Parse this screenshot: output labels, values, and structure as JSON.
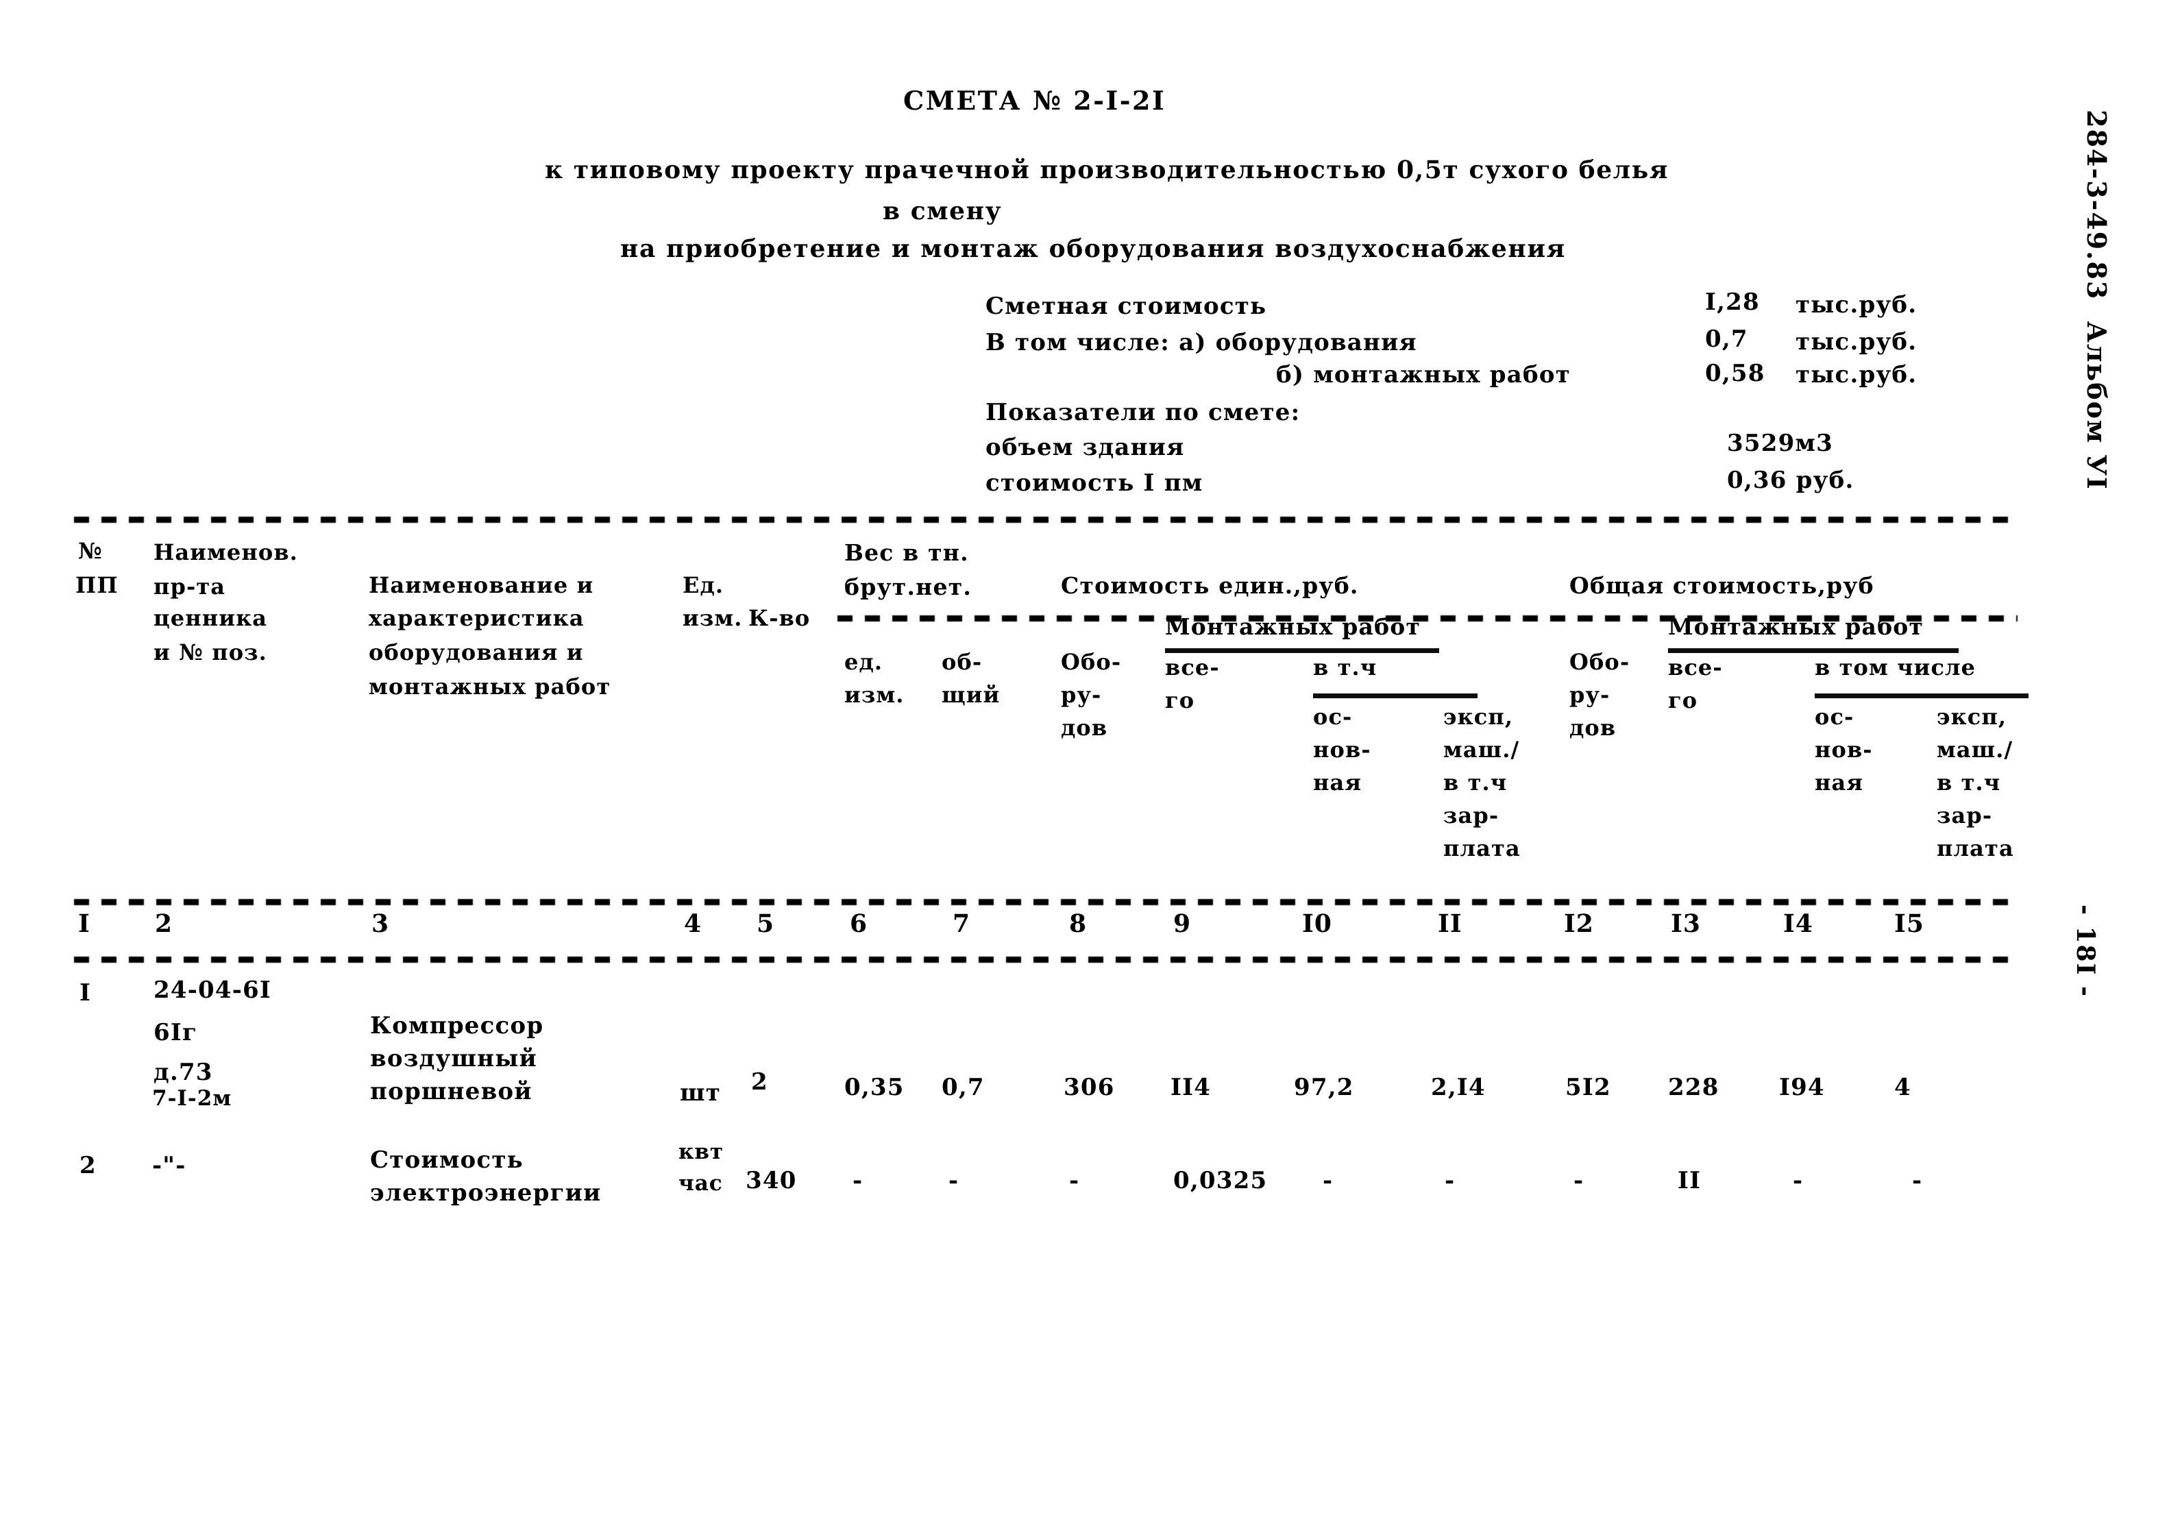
{
  "document": {
    "title": "СМЕТА № 2-I-2I",
    "subtitle_line1": "к типовому проекту прачечной производительностью 0,5т сухого белья",
    "subtitle_line2": "в смену",
    "subtitle_line3": "на приобретение и монтаж оборудования воздухоснабжения",
    "margin_code": "284-3-49.83  Альбом УI",
    "page_marker": "- 18I -"
  },
  "summary": {
    "rows": [
      {
        "label": "Сметная стоимость",
        "value": "I,28",
        "unit": "тыс.руб."
      },
      {
        "label": "В том числе: а) оборудования",
        "value": "0,7",
        "unit": "тыс.руб."
      },
      {
        "label": "б) монтажных работ",
        "value": "0,58",
        "unit": "тыс.руб."
      }
    ],
    "indicators_label": "Показатели по смете:",
    "indicators": [
      {
        "label": "объем здания",
        "value": "3529м3"
      },
      {
        "label": "стоимость I пм",
        "value": "0,36 руб."
      }
    ]
  },
  "table": {
    "headers": {
      "col1_l1": "№",
      "col1_l2": "ПП",
      "col2_l1": "Наименов.",
      "col2_l2": "пр-та",
      "col2_l3": "ценника",
      "col2_l4": "и № поз.",
      "col3_l1": "Наименование и",
      "col3_l2": "характеристика",
      "col3_l3": "оборудования и",
      "col3_l4": "монтажных работ",
      "col4_l1": "Ед.",
      "col4_l2": "изм.",
      "col5_l1": "К-во",
      "group_weight_l1": "Вес в тн.",
      "group_weight_l2": "брут.нет.",
      "col6_l1": "ед.",
      "col6_l2": "изм.",
      "col7_l1": "об-",
      "col7_l2": "щий",
      "group_unitcost": "Стоимость един.,руб.",
      "col8_l1": "Обо-",
      "col8_l2": "ру-",
      "col8_l3": "дов",
      "group_mount_unit": "Монтажных работ",
      "col9_l1": "все-",
      "col9_l2": "го",
      "sub_vtch_unit": "в т.ч",
      "col10_l1": "ос-",
      "col10_l2": "нов-",
      "col10_l3": "ная",
      "col11_l1": "эксп,",
      "col11_l2": "маш./",
      "col11_l3": "в т.ч",
      "col11_l4": "зар-",
      "col11_l5": "плата",
      "group_totalcost": "Общая стоимость,руб",
      "col12_l1": "Обо-",
      "col12_l2": "ру-",
      "col12_l3": "дов",
      "group_mount_total": "Монтажных работ",
      "col13_l1": "все-",
      "col13_l2": "го",
      "sub_vtch_total": "в том числе",
      "col14_l1": "ос-",
      "col14_l2": "нов-",
      "col14_l3": "ная",
      "col15_l1": "эксп,",
      "col15_l2": "маш./",
      "col15_l3": "в т.ч",
      "col15_l4": "зар-",
      "col15_l5": "плата"
    },
    "column_numbers": [
      "I",
      "2",
      "3",
      "4",
      "5",
      "6",
      "7",
      "8",
      "9",
      "I0",
      "II",
      "I2",
      "I3",
      "I4",
      "I5"
    ],
    "rows": [
      {
        "num": "I",
        "ref_l1": "24-04-6I",
        "ref_l2": "6Iг",
        "ref_l3": "д.73",
        "ref_l4": "7-I-2м",
        "name_l1": "Компрессор",
        "name_l2": "воздушный",
        "name_l3": "поршневой",
        "unit": "шт",
        "qty": "2",
        "w_unit": "0,35",
        "w_total": "0,7",
        "uc_equip": "306",
        "uc_mount_total": "II4",
        "uc_mount_main": "97,2",
        "uc_mount_mach": "2,I4",
        "tc_equip": "5I2",
        "tc_mount_total": "228",
        "tc_mount_main": "I94",
        "tc_mount_mach": "4"
      },
      {
        "num": "2",
        "ref_l1": "-\"-",
        "ref_l2": "",
        "ref_l3": "",
        "ref_l4": "",
        "name_l1": "Стоимость",
        "name_l2": "электроэнергии",
        "name_l3": "",
        "unit_l1": "квт",
        "unit_l2": "час",
        "qty": "340",
        "w_unit": "-",
        "w_total": "-",
        "uc_equip": "-",
        "uc_mount_total": "0,0325",
        "uc_mount_main": "-",
        "uc_mount_mach": "-",
        "tc_equip": "-",
        "tc_mount_total": "II",
        "tc_mount_main": "-",
        "tc_mount_mach": "-"
      }
    ]
  }
}
